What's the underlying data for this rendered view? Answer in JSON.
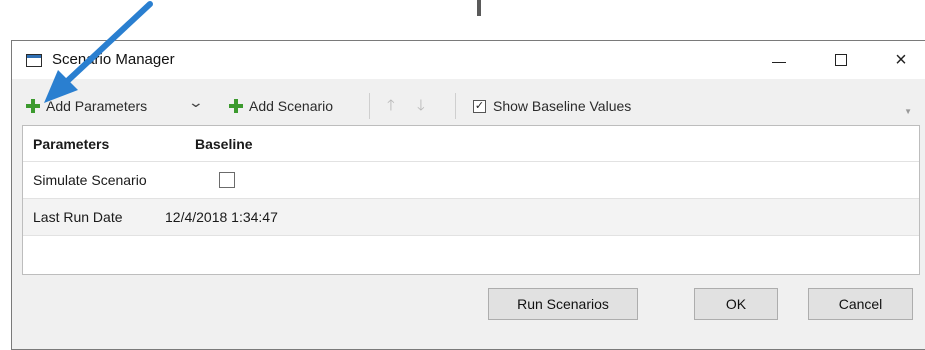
{
  "window": {
    "title": "Scenario Manager",
    "controls": {
      "minimize": "minimize-icon",
      "maximize": "maximize-icon",
      "close": "×"
    }
  },
  "toolbar": {
    "add_parameters_label": "Add Parameters",
    "add_parameters_dropdown_icon": "chevron-down-icon",
    "add_scenario_label": "Add Scenario",
    "move_up_icon": "up-arrow-icon",
    "move_down_icon": "down-arrow-icon",
    "move_up_glyph": "🡑",
    "move_down_glyph": "🡓",
    "show_baseline_label": "Show Baseline Values",
    "show_baseline_checked": true,
    "show_baseline_mark": "✓"
  },
  "grid": {
    "columns": [
      "Parameters",
      "Baseline"
    ],
    "rows": [
      {
        "parameter": "Simulate Scenario",
        "baseline_checked": false
      },
      {
        "parameter": "Last Run Date",
        "baseline": "12/4/2018 1:34:47"
      }
    ]
  },
  "buttons": {
    "run": "Run Scenarios",
    "ok": "OK",
    "cancel": "Cancel"
  },
  "colors": {
    "add_icon": "#3c9a2e",
    "annotation_arrow": "#2a7fd0"
  }
}
